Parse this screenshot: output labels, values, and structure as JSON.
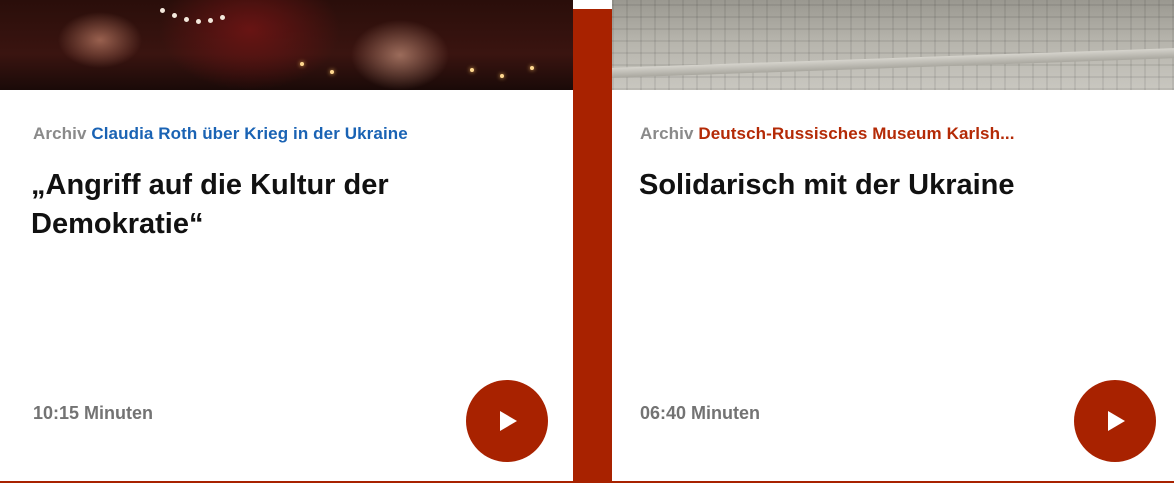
{
  "cards": [
    {
      "archive_label": "Archiv",
      "topic": "Claudia Roth über Krieg in der Ukraine",
      "headline": "„Angriff auf die Kultur der Demokratie“",
      "duration": "10:15 Minuten",
      "accent": "#1a63b4",
      "play_icon": "play-icon"
    },
    {
      "archive_label": "Archiv",
      "topic": "Deutsch-Russisches Museum Karlsh...",
      "headline": "Solidarisch mit der Ukraine",
      "duration": "06:40 Minuten",
      "accent": "#b42a06",
      "play_icon": "play-icon"
    }
  ],
  "colors": {
    "brand": "#a82200",
    "archive_gray": "#8a8a8a",
    "headline": "#111111"
  }
}
